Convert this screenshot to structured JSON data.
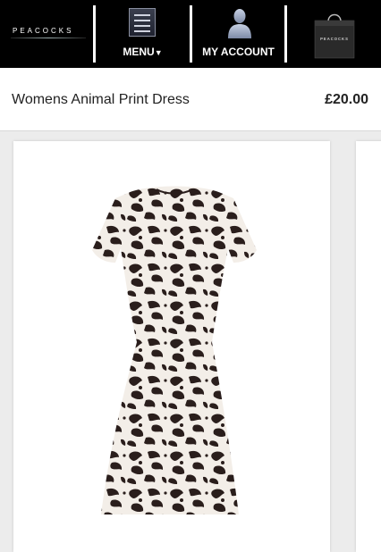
{
  "header": {
    "logo_text": "PEACOCKS",
    "menu_label": "MENU",
    "menu_arrow": "▼",
    "account_label": "MY ACCOUNT",
    "bag_brand": "PEACOCKS"
  },
  "product": {
    "title": "Womens Animal Print Dress",
    "price": "£20.00"
  },
  "colors": {
    "header_bg": "#000000",
    "page_bg": "#ececec",
    "print_dark": "#2a1e1c",
    "print_light": "#f3eee8"
  }
}
